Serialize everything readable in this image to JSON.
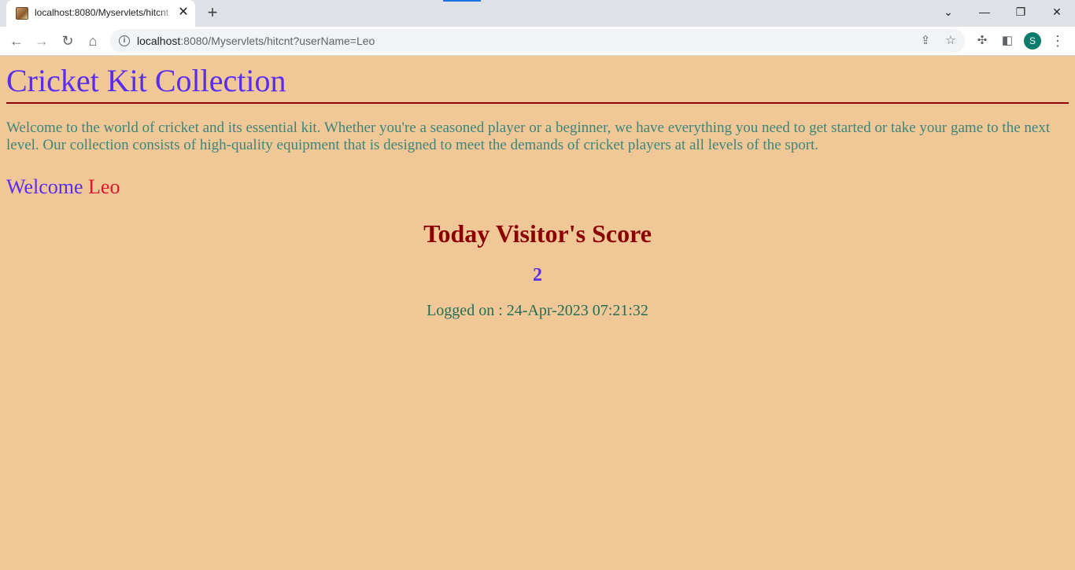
{
  "browser": {
    "tab": {
      "title": "localhost:8080/Myservlets/hitcnt",
      "close_glyph": "✕"
    },
    "new_tab_glyph": "+",
    "window_controls": {
      "list_glyph": "⌄",
      "minimize_glyph": "—",
      "restore_glyph": "❐",
      "close_glyph": "✕"
    },
    "nav": {
      "back_glyph": "←",
      "forward_glyph": "→",
      "reload_glyph": "↻",
      "home_glyph": "⌂"
    },
    "address": {
      "host": "localhost",
      "rest": ":8080/Myservlets/hitcnt?userName=Leo",
      "info_glyph": "i"
    },
    "share_glyph": "⇪",
    "star_glyph": "☆",
    "extensions_glyph": "✣",
    "sidepanel_glyph": "◧",
    "profile_initial": "S",
    "menu_glyph": "⋮"
  },
  "page": {
    "heading": "Cricket Kit Collection",
    "intro": "Welcome to the world of cricket and its essential kit. Whether you're a seasoned player or a beginner, we have everything you need to get started or take your game to the next level. Our collection consists of high-quality equipment that is designed to meet the demands of cricket players at all levels of the sport.",
    "welcome_word": "Welcome",
    "user_name": "Leo",
    "score_title": "Today Visitor's Score",
    "score_value": "2",
    "logged_on": "Logged on : 24-Apr-2023 07:21:32"
  },
  "colors": {
    "page_background": "#f0c898",
    "heading": "#5a2cf0",
    "rule": "#8b0000",
    "intro_text": "#3d8579",
    "user_name": "#e0162b",
    "score_title": "#8b0000",
    "logged_text": "#226e55"
  }
}
